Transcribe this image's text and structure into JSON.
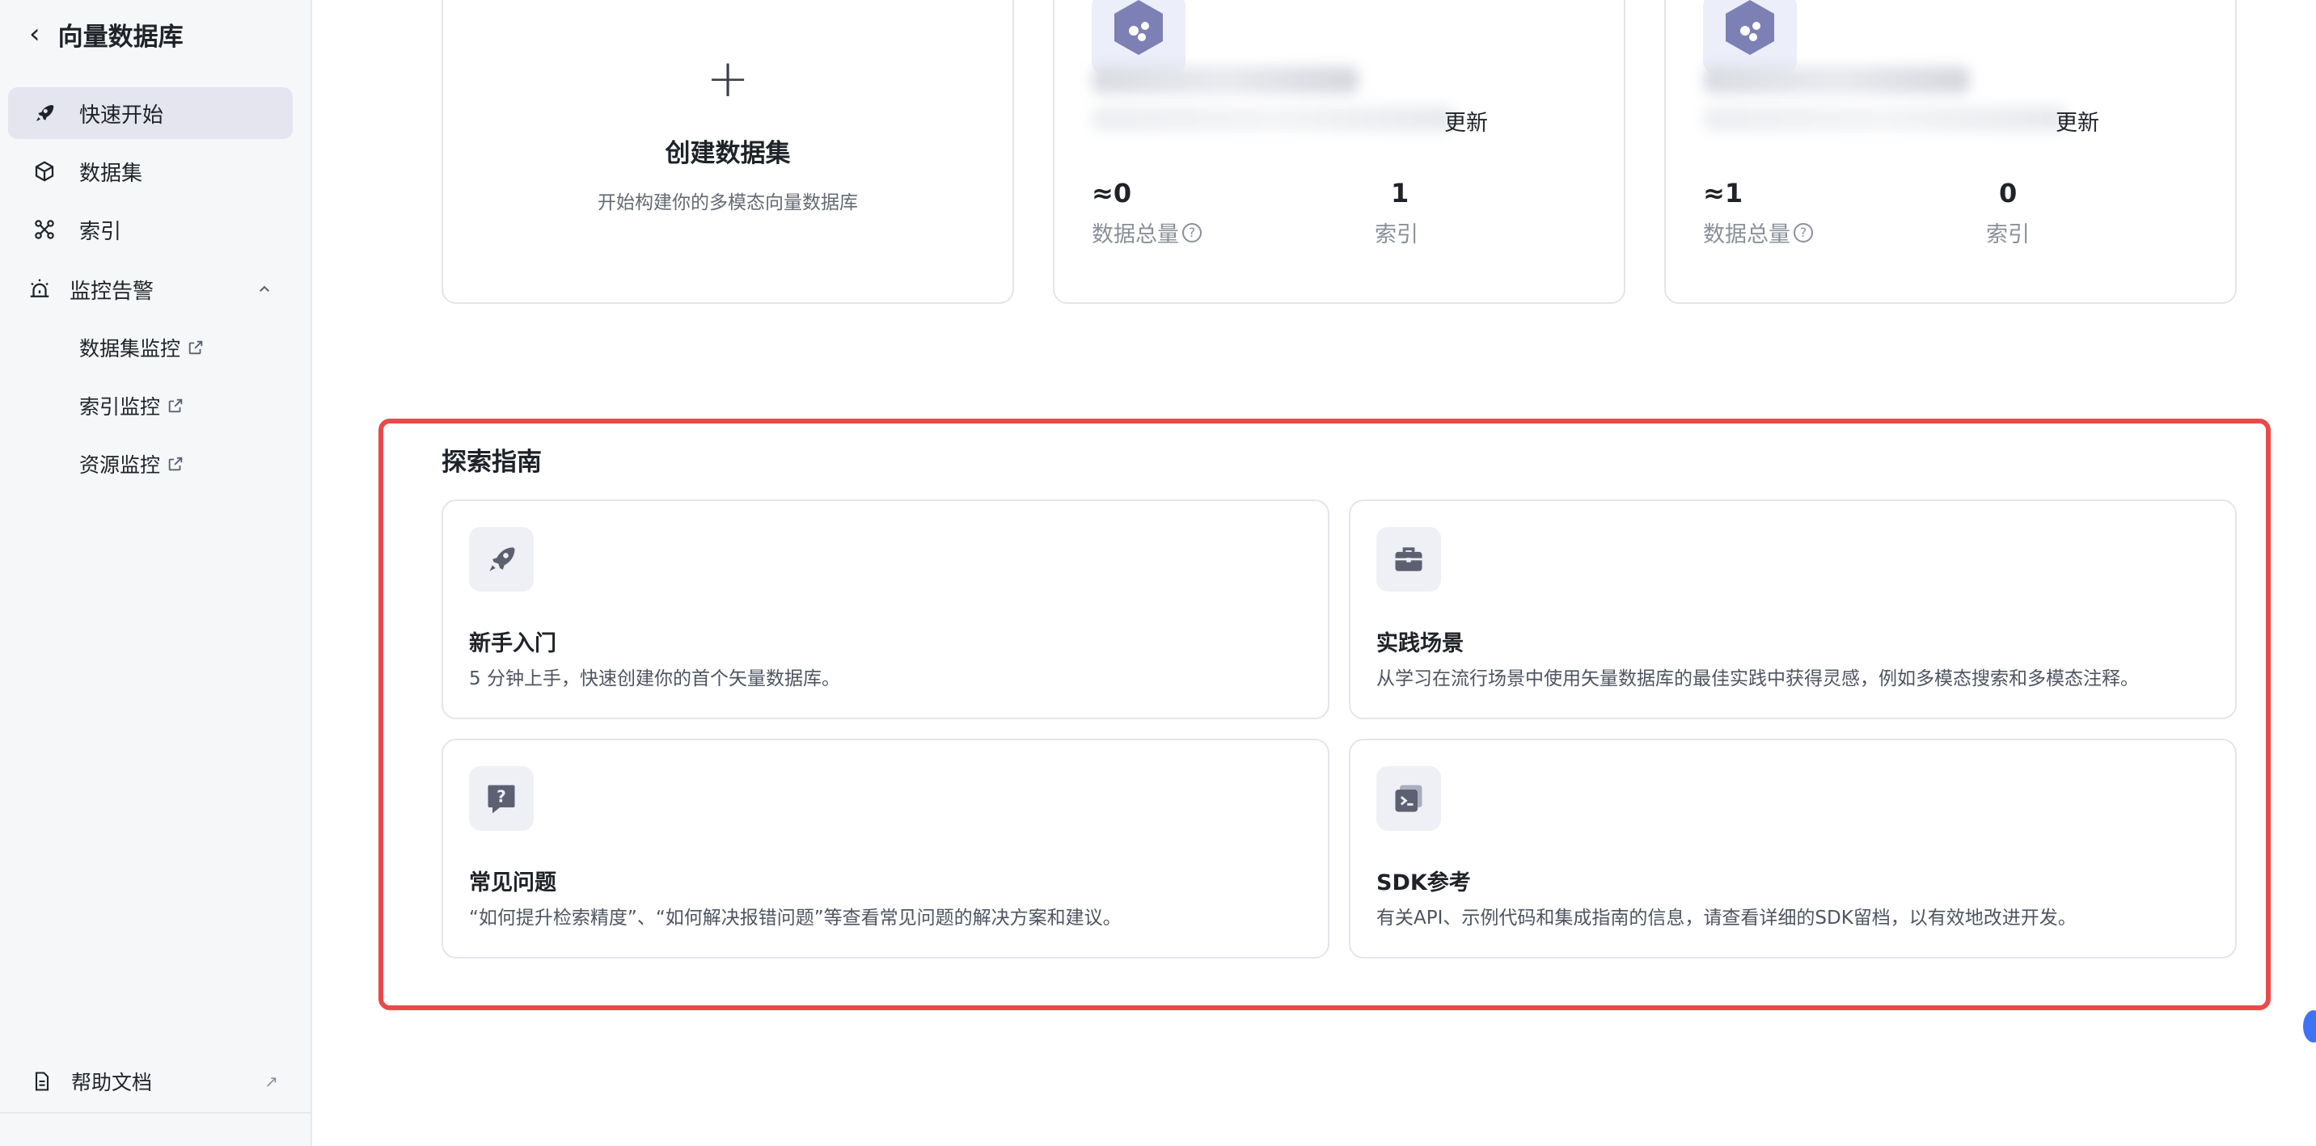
{
  "sidebar": {
    "title": "向量数据库",
    "items": [
      {
        "label": "快速开始",
        "icon": "rocket-icon",
        "active": true
      },
      {
        "label": "数据集",
        "icon": "cube-icon"
      },
      {
        "label": "索引",
        "icon": "graph-nodes-icon"
      },
      {
        "label": "监控告警",
        "icon": "alarm-icon",
        "expanded": true
      }
    ],
    "sub_items": [
      {
        "label": "数据集监控",
        "icon": "external-link-icon"
      },
      {
        "label": "索引监控",
        "icon": "external-link-icon"
      },
      {
        "label": "资源监控",
        "icon": "external-link-icon"
      }
    ],
    "help": {
      "label": "帮助文档",
      "icon": "document-icon"
    }
  },
  "create_card": {
    "plus": "+",
    "title": "创建数据集",
    "desc": "开始构建你的多模态向量数据库"
  },
  "datasets": [
    {
      "updated": "更新",
      "count": "≈0",
      "count_label": "数据总量",
      "index_count": "1",
      "index_label": "索引"
    },
    {
      "updated": "更新",
      "count": "≈1",
      "count_label": "数据总量",
      "index_count": "0",
      "index_label": "索引"
    }
  ],
  "explore": {
    "title": "探索指南",
    "guides": [
      {
        "title": "新手入门",
        "desc": "5 分钟上手，快速创建你的首个矢量数据库。",
        "icon": "rocket-icon"
      },
      {
        "title": "实践场景",
        "desc": "从学习在流行场景中使用矢量数据库的最佳实践中获得灵感，例如多模态搜索和多模态注释。",
        "icon": "briefcase-icon"
      },
      {
        "title": "常见问题",
        "desc": "“如何提升检索精度”、“如何解决报错问题”等查看常见问题的解决方案和建议。",
        "icon": "question-bubble-icon"
      },
      {
        "title": "SDK参考",
        "desc": "有关API、示例代码和集成指南的信息，请查看详细的SDK留档，以有效地改进开发。",
        "icon": "terminal-icon"
      }
    ]
  },
  "colors": {
    "accent_highlight": "#e84a4a",
    "active_nav_bg": "#e4e5ee",
    "icon_color": "#5c6070"
  }
}
